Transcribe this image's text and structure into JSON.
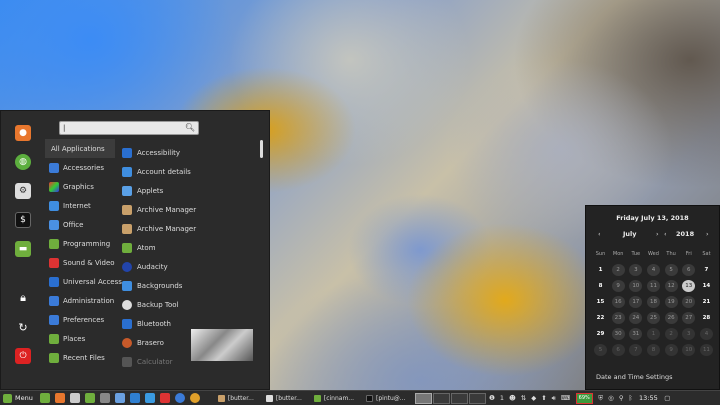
{
  "menu": {
    "panel_label": "Menu",
    "search": {
      "value": "|",
      "placeholder": ""
    },
    "categories": [
      "All Applications",
      "Accessories",
      "Graphics",
      "Internet",
      "Office",
      "Programming",
      "Sound & Video",
      "Universal Access",
      "Administration",
      "Preferences",
      "Places",
      "Recent Files"
    ],
    "apps": [
      "Accessibility",
      "Account details",
      "Applets",
      "Archive Manager",
      "Archive Manager",
      "Atom",
      "Audacity",
      "Backgrounds",
      "Backup Tool",
      "Bluetooth",
      "Brasero",
      "Calculator"
    ]
  },
  "calendar": {
    "date_heading": "Friday July 13, 2018",
    "month": "July",
    "year": "2018",
    "weekdays": [
      "Sun",
      "Mon",
      "Tue",
      "Wed",
      "Thu",
      "Fri",
      "Sat"
    ],
    "weeks": [
      [
        "1",
        "2",
        "3",
        "4",
        "5",
        "6",
        "7"
      ],
      [
        "8",
        "9",
        "10",
        "11",
        "12",
        "13",
        "14"
      ],
      [
        "15",
        "16",
        "17",
        "18",
        "19",
        "20",
        "21"
      ],
      [
        "22",
        "23",
        "24",
        "25",
        "26",
        "27",
        "28"
      ],
      [
        "29",
        "30",
        "31",
        "1",
        "2",
        "3",
        "4"
      ],
      [
        "5",
        "6",
        "7",
        "8",
        "9",
        "10",
        "11"
      ]
    ],
    "selected_day": "13",
    "settings_label": "Date and Time Settings"
  },
  "panel": {
    "windows": [
      "[butter...",
      "[butter...",
      "[cinnam...",
      "[pintu@..."
    ],
    "tray_workspace_count": "1",
    "battery": "69%",
    "clock": "13:55"
  },
  "colors": {
    "menu_bg": "#2b2b2b",
    "panel_bg": "#2c2c2c",
    "accent_green": "#6fae3d"
  }
}
